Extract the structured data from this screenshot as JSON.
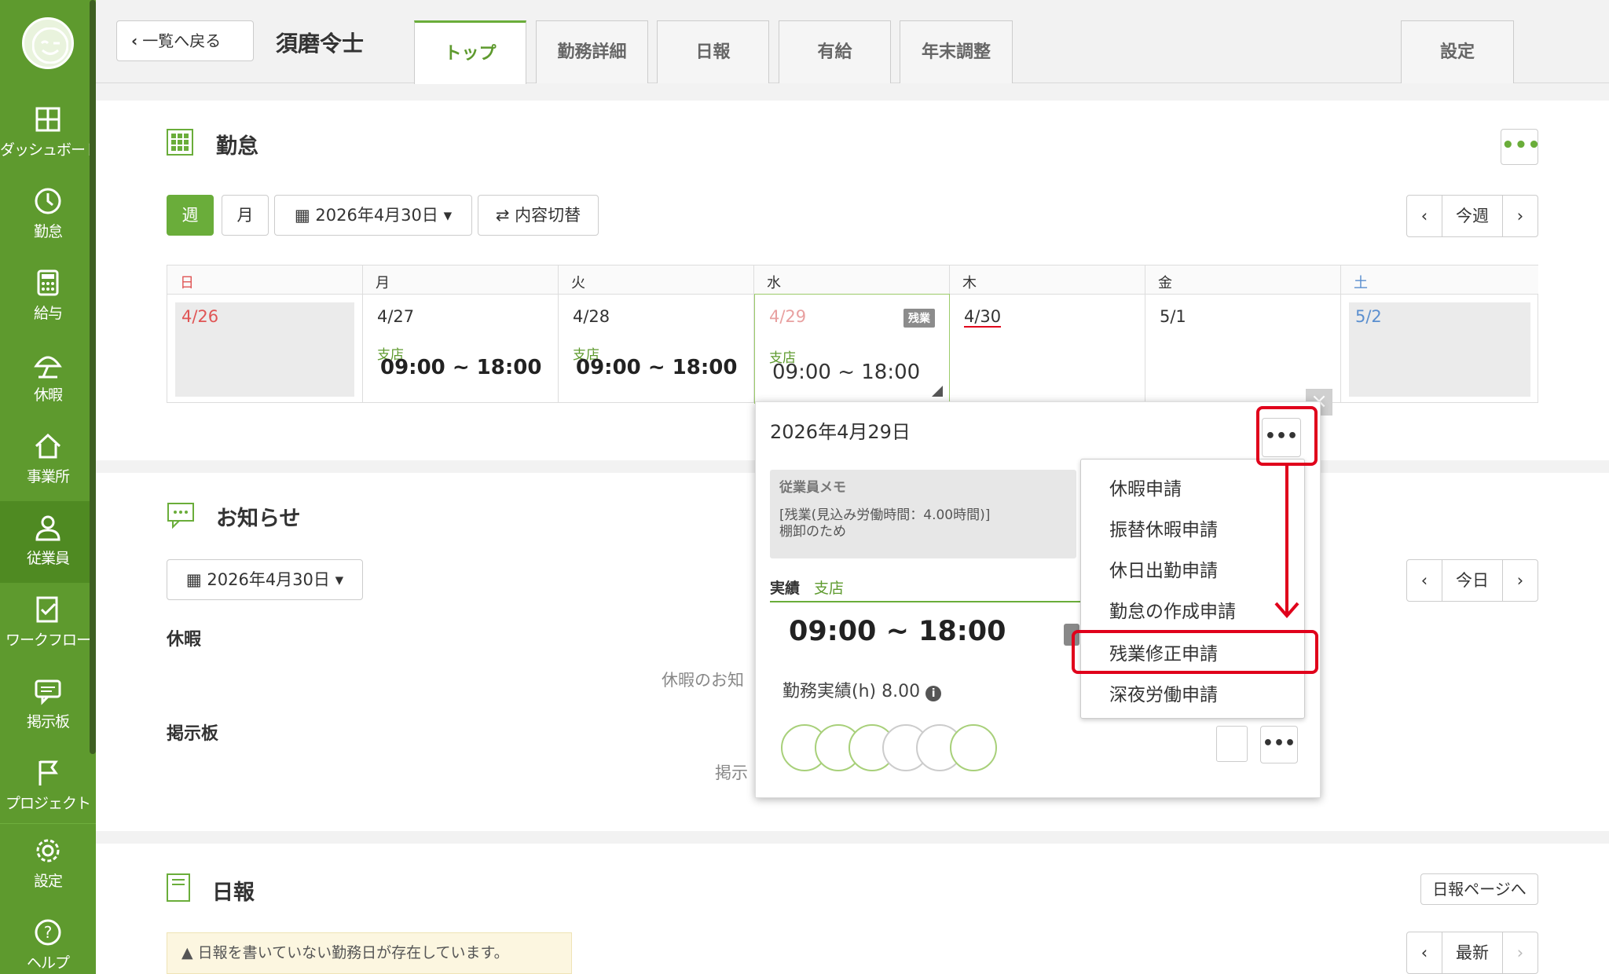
{
  "sidebar": {
    "items": [
      {
        "label": "ダッシュボード",
        "icon": "dashboard-icon"
      },
      {
        "label": "勤怠",
        "icon": "clock-icon"
      },
      {
        "label": "給与",
        "icon": "calculator-icon"
      },
      {
        "label": "休暇",
        "icon": "umbrella-icon"
      },
      {
        "label": "事業所",
        "icon": "home-icon"
      },
      {
        "label": "従業員",
        "icon": "person-icon"
      },
      {
        "label": "ワークフロー",
        "icon": "checklist-icon"
      },
      {
        "label": "掲示板",
        "icon": "message-icon"
      },
      {
        "label": "プロジェクト",
        "icon": "flag-icon"
      }
    ],
    "bottom": [
      {
        "label": "設定",
        "icon": "gear-icon"
      },
      {
        "label": "ヘルプ",
        "icon": "help-icon"
      }
    ]
  },
  "header": {
    "back_label": "一覧へ戻る",
    "employee_name": "須磨令士",
    "tabs": [
      "トップ",
      "勤務詳細",
      "日報",
      "有給",
      "年末調整"
    ],
    "settings_tab": "設定"
  },
  "attendance": {
    "title": "勤怠",
    "view_week": "週",
    "view_month": "月",
    "date_picker": "2026年4月30日",
    "toggle_label": "内容切替",
    "nav_label": "今週",
    "days": [
      {
        "dow": "日",
        "date": "4/26",
        "branch": "",
        "time": ""
      },
      {
        "dow": "月",
        "date": "4/27",
        "branch": "支店",
        "time": "09:00 ~ 18:00"
      },
      {
        "dow": "火",
        "date": "4/28",
        "branch": "支店",
        "time": "09:00 ~ 18:00"
      },
      {
        "dow": "水",
        "date": "4/29",
        "branch": "支店",
        "time": "09:00 ~ 18:00",
        "badge": "残業"
      },
      {
        "dow": "木",
        "date": "4/30",
        "branch": "",
        "time": ""
      },
      {
        "dow": "金",
        "date": "5/1",
        "branch": "",
        "time": ""
      },
      {
        "dow": "土",
        "date": "5/2",
        "branch": "",
        "time": ""
      }
    ]
  },
  "notice": {
    "title": "お知らせ",
    "date_picker": "2026年4月30日",
    "nav_label": "今日",
    "leave_label": "休暇",
    "leave_empty": "休暇のお知",
    "board_label": "掲示板",
    "board_empty": "掲示"
  },
  "daily": {
    "title": "日報",
    "page_link": "日報ページへ",
    "warning": "日報を書いていない勤務日が存在しています。",
    "nav_label": "最新"
  },
  "popup": {
    "date": "2026年4月29日",
    "memo_title": "従業員メモ",
    "memo_body": "[残業(見込み労働時間：4.00時間)]\n棚卸のため",
    "actual_label": "実績",
    "actual_branch": "支店",
    "time": "09:00 ~ 18:00",
    "hours_label": "勤務実績(h)",
    "hours_value": "8.00"
  },
  "dropdown": {
    "items": [
      "休暇申請",
      "振替休暇申請",
      "休日出勤申請",
      "勤怠の作成申請",
      "残業修正申請",
      "深夜労働申請"
    ]
  },
  "colors": {
    "brand": "#5e9a2e",
    "accent": "#6aad3a",
    "highlight": "#e0001b"
  }
}
